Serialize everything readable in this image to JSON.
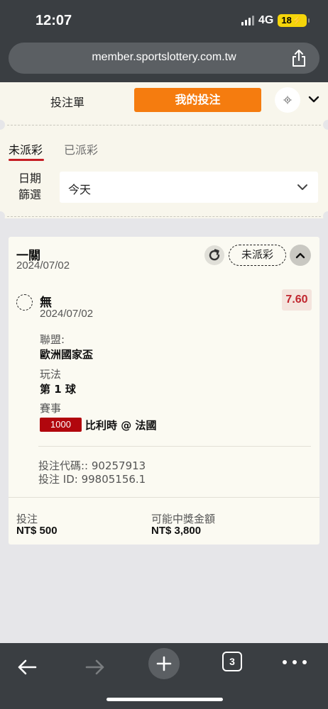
{
  "status_bar": {
    "time": "12:07",
    "network": "4G",
    "battery": "18"
  },
  "browser": {
    "url": "member.sportslottery.com.tw",
    "tab_count": "3"
  },
  "header": {
    "betslip_label": "投注單",
    "mybets_label": "我的投注"
  },
  "filter": {
    "tabs": [
      {
        "label": "未派彩"
      },
      {
        "label": "已派彩"
      }
    ],
    "date_label": "日期篩選",
    "date_value": "今天"
  },
  "bet": {
    "type": "一關",
    "date": "2024/07/02",
    "status": "未派彩",
    "selection": {
      "name": "無",
      "date": "2024/07/02",
      "odds": "7.60"
    },
    "league_label": "聯盟:",
    "league": "歐洲國家盃",
    "market_label": "玩法",
    "market": "第 1 球",
    "event_label": "賽事",
    "event_code": "1000",
    "event_name": "比利時 @ 法國",
    "bet_code": "投注代碼:: 90257913",
    "bet_id": "投注 ID: 99805156.1",
    "stake_label": "投注",
    "stake": "NT$ 500",
    "payout_label": "可能中獎金額",
    "payout": "NT$ 3,800"
  },
  "colors": {
    "accent": "#f57c0f",
    "active_underline": "#c51d24",
    "odds": "#c1262e",
    "event_code_bg": "#b1060d"
  },
  "icons": [
    "share-icon",
    "gear-icon",
    "chevron-down-icon",
    "refresh-icon",
    "chevron-up-icon",
    "back-arrow-icon",
    "forward-arrow-icon",
    "plus-icon",
    "tabs-icon",
    "more-icon"
  ]
}
